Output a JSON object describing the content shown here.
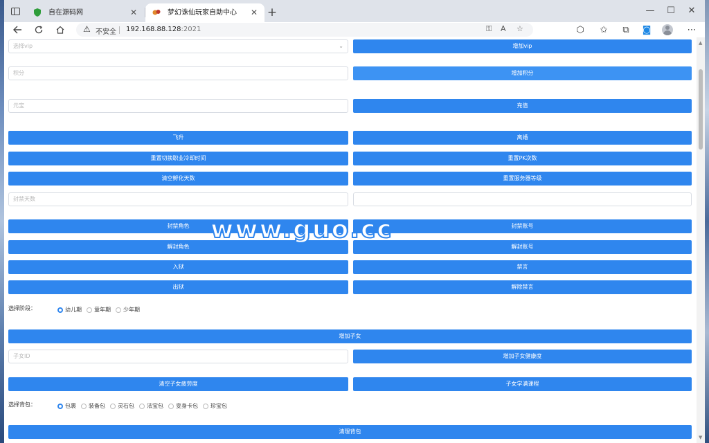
{
  "browser": {
    "tabs": [
      {
        "title": "自在源码网",
        "close": "✕"
      },
      {
        "title": "梦幻诛仙玩家自助中心",
        "close": "✕"
      }
    ],
    "new_tab": "+",
    "window_controls": {
      "minimize": "—",
      "maximize": "☐",
      "close": "✕"
    },
    "security_text": "不安全",
    "url_host": "192.168.88.128",
    "url_port": ":2021"
  },
  "form": {
    "vip_select": "选择vip",
    "add_vip": "增加vip",
    "points_placeholder": "积分",
    "add_points": "增加积分",
    "yuanbao_placeholder": "元宝",
    "recharge": "充值",
    "ascend": "飞升",
    "divorce": "离婚",
    "reset_class_cooldown": "重置切换职业冷却时间",
    "reset_pk": "重置PK次数",
    "clear_hatch_days": "清空孵化天数",
    "reset_server_level": "重置服务器等级",
    "ban_days_placeholder": "封禁天数",
    "ban_role": "封禁角色",
    "ban_account": "封禁账号",
    "unban_role": "解封角色",
    "unban_account": "解封账号",
    "jail": "入狱",
    "mute": "禁言",
    "release": "出狱",
    "unmute": "解除禁言",
    "stage_label": "选择阶段：",
    "stages": [
      "幼儿期",
      "童年期",
      "少年期"
    ],
    "add_child": "增加子女",
    "child_id_placeholder": "子女ID",
    "add_child_health": "增加子女健康度",
    "clear_child_fatigue": "清空子女疲劳度",
    "child_learn_course": "子女学满课程",
    "bag_label": "选择背包：",
    "bags": [
      "包裹",
      "装备包",
      "灵石包",
      "法宝包",
      "变身卡包",
      "珍宝包"
    ],
    "clear_bag": "清理背包"
  },
  "watermark": "www.guo.cc",
  "colors": {
    "primary": "#2f86ee",
    "tabbar": "#dfe3ea"
  }
}
